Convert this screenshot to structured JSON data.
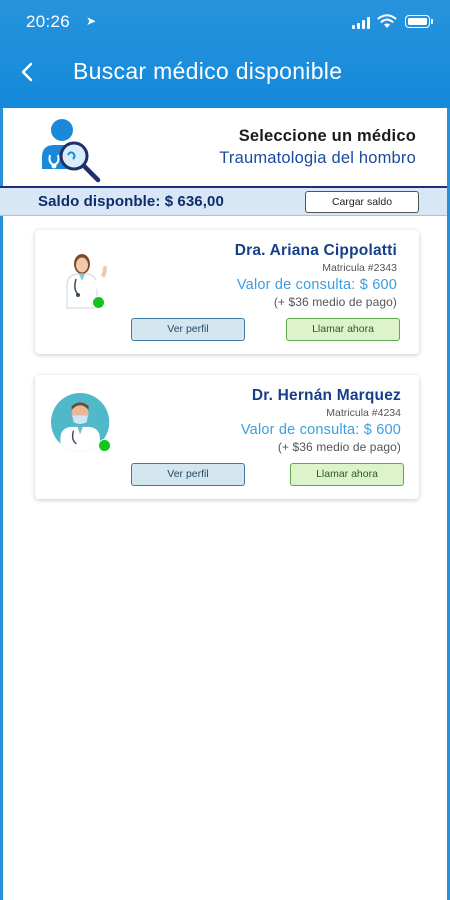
{
  "status_bar": {
    "time": "20:26",
    "location_icon": "location-arrow-icon",
    "icons": [
      "signal-icon",
      "wifi-icon",
      "battery-icon"
    ]
  },
  "header": {
    "back_icon": "chevron-left-icon",
    "title": "Buscar médico disponible"
  },
  "selection": {
    "icon": "doctor-search-icon",
    "title": "Seleccione un médico",
    "specialty": "Traumatologia del hombro"
  },
  "balance": {
    "label": "Saldo disponble: $ 636,00",
    "load_button": "Cargar saldo"
  },
  "doctors": [
    {
      "name": "Dra. Ariana Cippolatti",
      "license": "Matricula #2343",
      "price": "Valor de consulta: $ 600",
      "fee": "(+ $36 medio de pago)",
      "profile_button": "Ver perfil",
      "call_button": "Llamar ahora",
      "online": true,
      "avatar_icon": "female-doctor-avatar"
    },
    {
      "name": "Dr. Hernán Marquez",
      "license": "Matricula #4234",
      "price": "Valor de consulta: $ 600",
      "fee": "(+ $36 medio de pago)",
      "profile_button": "Ver perfil",
      "call_button": "Llamar ahora",
      "online": true,
      "avatar_icon": "male-doctor-avatar"
    }
  ],
  "colors": {
    "primary_blue": "#1a8ad8",
    "dark_navy": "#173e8a",
    "online_green": "#13c41b",
    "price_blue": "#3a9fe0"
  }
}
